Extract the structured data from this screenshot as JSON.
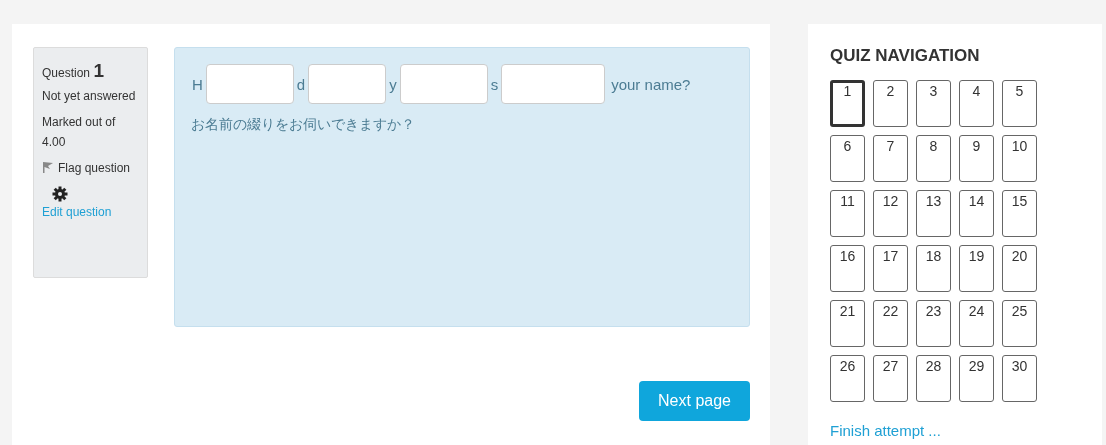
{
  "question_info": {
    "label": "Question",
    "number": "1",
    "status": "Not yet answered",
    "marks": "Marked out of 4.00",
    "flag": "Flag question",
    "edit": "Edit question"
  },
  "question": {
    "parts": [
      {
        "kind": "text",
        "text": "H"
      },
      {
        "kind": "blank"
      },
      {
        "kind": "text",
        "text": "d"
      },
      {
        "kind": "blank"
      },
      {
        "kind": "text",
        "text": "y"
      },
      {
        "kind": "blank"
      },
      {
        "kind": "text",
        "text": "s"
      },
      {
        "kind": "blank"
      },
      {
        "kind": "text",
        "text": "your name?"
      }
    ],
    "translation": "お名前の綴りをお伺いできますか？"
  },
  "next_button": "Next page",
  "quiz_navigation": {
    "title": "QUIZ NAVIGATION",
    "buttons": [
      {
        "label": "1",
        "selected": true
      },
      {
        "label": "2",
        "selected": false
      },
      {
        "label": "3",
        "selected": false
      },
      {
        "label": "4",
        "selected": false
      },
      {
        "label": "5",
        "selected": false
      },
      {
        "label": "6",
        "selected": false
      },
      {
        "label": "7",
        "selected": false
      },
      {
        "label": "8",
        "selected": false
      },
      {
        "label": "9",
        "selected": false
      },
      {
        "label": "10",
        "selected": false
      },
      {
        "label": "11",
        "selected": false
      },
      {
        "label": "12",
        "selected": false
      },
      {
        "label": "13",
        "selected": false
      },
      {
        "label": "14",
        "selected": false
      },
      {
        "label": "15",
        "selected": false
      },
      {
        "label": "16",
        "selected": false
      },
      {
        "label": "17",
        "selected": false
      },
      {
        "label": "18",
        "selected": false
      },
      {
        "label": "19",
        "selected": false
      },
      {
        "label": "20",
        "selected": false
      },
      {
        "label": "21",
        "selected": false
      },
      {
        "label": "22",
        "selected": false
      },
      {
        "label": "23",
        "selected": false
      },
      {
        "label": "24",
        "selected": false
      },
      {
        "label": "25",
        "selected": false
      },
      {
        "label": "26",
        "selected": false
      },
      {
        "label": "27",
        "selected": false
      },
      {
        "label": "28",
        "selected": false
      },
      {
        "label": "29",
        "selected": false
      },
      {
        "label": "30",
        "selected": false
      }
    ],
    "finish": "Finish attempt ..."
  }
}
